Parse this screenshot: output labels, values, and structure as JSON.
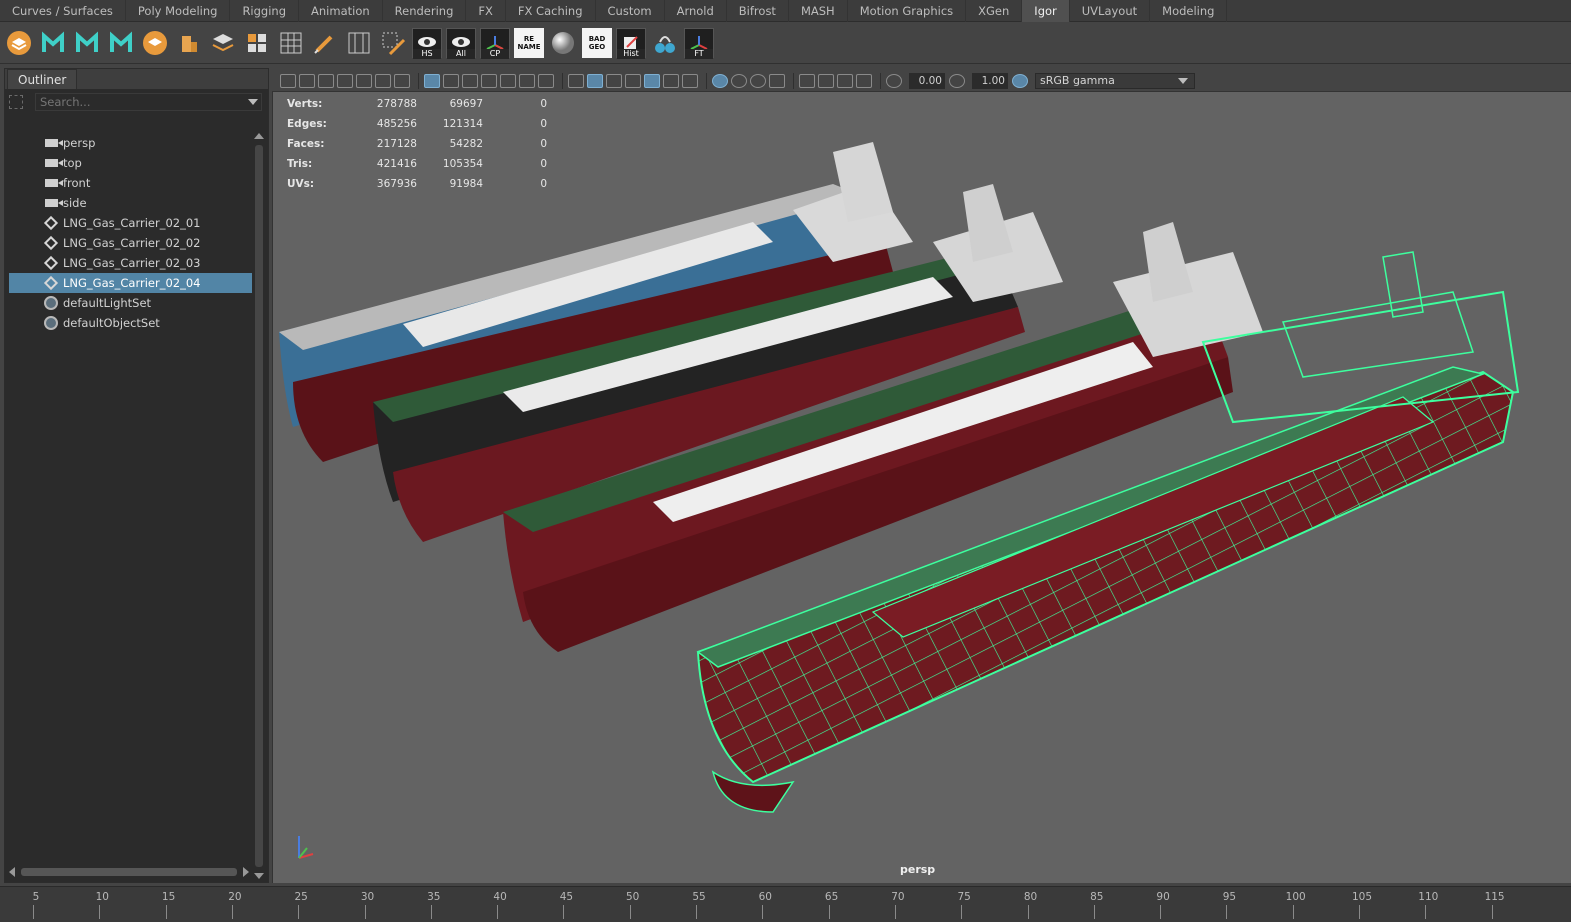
{
  "shelf": {
    "tabs": [
      "Curves / Surfaces",
      "Poly Modeling",
      "Rigging",
      "Animation",
      "Rendering",
      "FX",
      "FX Caching",
      "Custom",
      "Arnold",
      "Bifrost",
      "MASH",
      "Motion Graphics",
      "XGen",
      "Igor",
      "UVLayout",
      "Modeling"
    ],
    "active_tab": "Igor",
    "badges": {
      "hs": "HS",
      "all": "All",
      "cp": "CP",
      "rename": "RE NAME",
      "badgeo": "BAD GEO",
      "hist": "Hist",
      "ft": "FT"
    }
  },
  "outliner": {
    "tab": "Outliner",
    "search_placeholder": "Search...",
    "items": [
      {
        "label": "persp",
        "icon": "camera-icon"
      },
      {
        "label": "top",
        "icon": "camera-icon"
      },
      {
        "label": "front",
        "icon": "camera-icon"
      },
      {
        "label": "side",
        "icon": "camera-icon"
      },
      {
        "label": "LNG_Gas_Carrier_02_01",
        "icon": "mesh-transform-icon"
      },
      {
        "label": "LNG_Gas_Carrier_02_02",
        "icon": "mesh-transform-icon"
      },
      {
        "label": "LNG_Gas_Carrier_02_03",
        "icon": "mesh-transform-icon"
      },
      {
        "label": "LNG_Gas_Carrier_02_04",
        "icon": "mesh-transform-icon",
        "selected": true
      },
      {
        "label": "defaultLightSet",
        "icon": "set-icon"
      },
      {
        "label": "defaultObjectSet",
        "icon": "set-icon"
      }
    ]
  },
  "viewport": {
    "near_clip": "0.00",
    "far_value": "1.00",
    "color_space": "sRGB gamma",
    "camera": "persp",
    "hud": [
      {
        "label": "Verts:",
        "total": "278788",
        "selected": "69697",
        "comp": "0"
      },
      {
        "label": "Edges:",
        "total": "485256",
        "selected": "121314",
        "comp": "0"
      },
      {
        "label": "Faces:",
        "total": "217128",
        "selected": "54282",
        "comp": "0"
      },
      {
        "label": "Tris:",
        "total": "421416",
        "selected": "105354",
        "comp": "0"
      },
      {
        "label": "UVs:",
        "total": "367936",
        "selected": "91984",
        "comp": "0"
      }
    ]
  },
  "timeline": {
    "labels": [
      "5",
      "10",
      "15",
      "20",
      "25",
      "30",
      "35",
      "40",
      "45",
      "50",
      "55",
      "60",
      "65",
      "70",
      "75",
      "80",
      "85",
      "90",
      "95",
      "100",
      "105",
      "110",
      "115"
    ]
  },
  "colors": {
    "selection": "#5285a6",
    "wireframe": "#3dff9e",
    "hull_red": "#6e1a20",
    "deck_white": "#e6e6e6"
  }
}
